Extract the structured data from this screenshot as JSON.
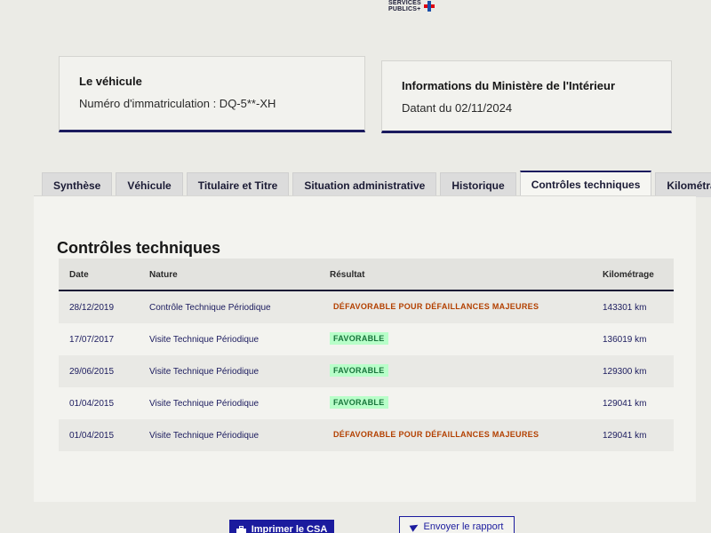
{
  "logo": {
    "line1": "SERVICES",
    "line2": "PUBLICS+"
  },
  "vehicle_card": {
    "title": "Le véhicule",
    "text": "Numéro d'immatriculation : DQ-5**-XH"
  },
  "ministry_card": {
    "title": "Informations du Ministère de l'Intérieur",
    "text": "Datant du 02/11/2024"
  },
  "tabs": [
    {
      "label": "Synthèse"
    },
    {
      "label": "Véhicule"
    },
    {
      "label": "Titulaire et Titre"
    },
    {
      "label": "Situation administrative"
    },
    {
      "label": "Historique"
    },
    {
      "label": "Contrôles techniques"
    },
    {
      "label": "Kilométrage"
    }
  ],
  "panel": {
    "title": "Contrôles techniques"
  },
  "table": {
    "headers": {
      "date": "Date",
      "nature": "Nature",
      "result": "Résultat",
      "km": "Kilométrage"
    },
    "rows": [
      {
        "date": "28/12/2019",
        "nature": "Contrôle Technique Périodique",
        "result": "DÉFAVORABLE POUR DÉFAILLANCES MAJEURES",
        "km": "143301 km"
      },
      {
        "date": "17/07/2017",
        "nature": "Visite Technique Périodique",
        "result": "FAVORABLE",
        "km": "136019 km"
      },
      {
        "date": "29/06/2015",
        "nature": "Visite Technique Périodique",
        "result": "FAVORABLE",
        "km": "129300 km"
      },
      {
        "date": "01/04/2015",
        "nature": "Visite Technique Périodique",
        "result": "FAVORABLE",
        "km": "129041 km"
      },
      {
        "date": "01/04/2015",
        "nature": "Visite Technique Périodique",
        "result": "DÉFAVORABLE POUR DÉFAILLANCES MAJEURES",
        "km": "129041 km"
      }
    ]
  },
  "buttons": {
    "print_label": "Imprimer le CSA",
    "send_label": "Envoyer le rapport"
  },
  "colors": {
    "primary": "#1b1b9e",
    "favorable_bg": "#b8fec9",
    "favorable_text": "#18753c",
    "defavorable_text": "#b34000"
  }
}
